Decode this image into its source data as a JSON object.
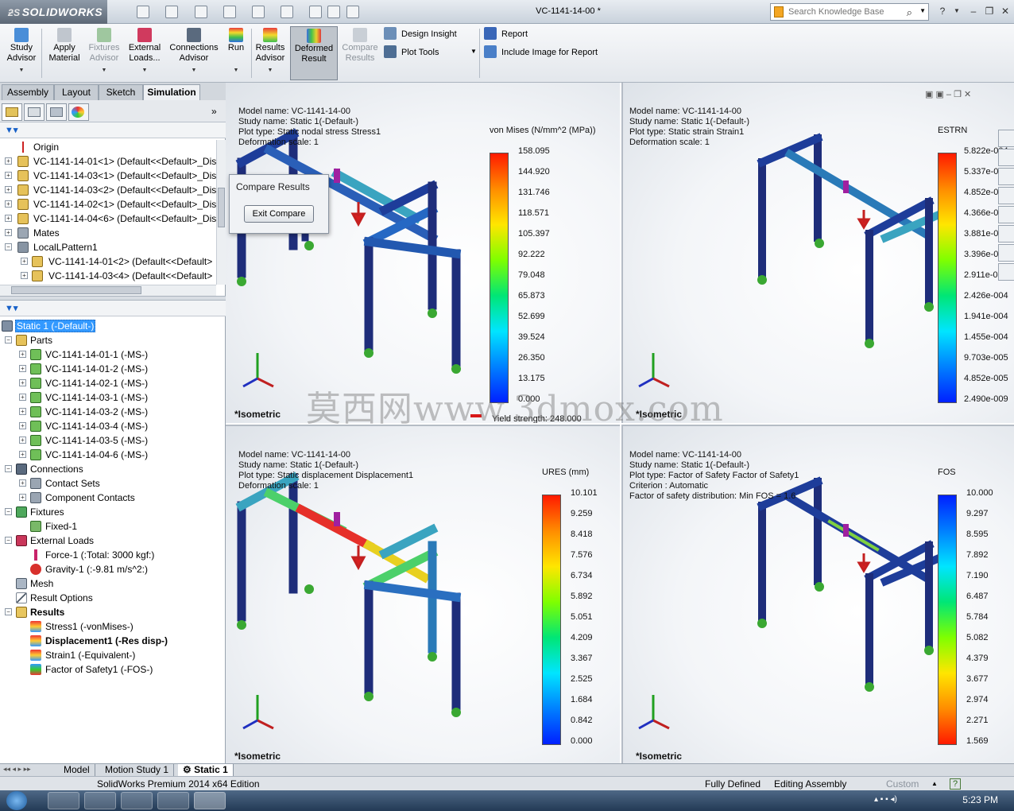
{
  "app": {
    "logo_text": "SOLIDWORKS",
    "doc_title": "VC-1141-14-00 *",
    "search_placeholder": "Search Knowledge Base",
    "help_label": "?"
  },
  "command_manager": {
    "buttons": [
      {
        "label1": "Study",
        "label2": "Advisor",
        "icon": "study-advisor-icon"
      },
      {
        "label1": "Apply",
        "label2": "Material",
        "icon": "apply-material-icon"
      },
      {
        "label1": "Fixtures",
        "label2": "Advisor",
        "icon": "fixtures-advisor-icon"
      },
      {
        "label1": "External",
        "label2": "Loads...",
        "icon": "external-loads-icon"
      },
      {
        "label1": "Connections",
        "label2": "Advisor",
        "icon": "connections-advisor-icon"
      },
      {
        "label1": "Run",
        "label2": "",
        "icon": "run-icon"
      },
      {
        "label1": "Results",
        "label2": "Advisor",
        "icon": "results-advisor-icon"
      },
      {
        "label1": "Deformed",
        "label2": "Result",
        "icon": "deformed-result-icon"
      },
      {
        "label1": "Compare",
        "label2": "Results",
        "icon": "compare-results-icon"
      }
    ],
    "design_insight": "Design Insight",
    "plot_tools": "Plot Tools",
    "report": "Report",
    "include_image": "Include Image for Report"
  },
  "tabs": [
    "Assembly",
    "Layout",
    "Sketch",
    "Simulation"
  ],
  "feature_tree": [
    {
      "label": "Origin"
    },
    {
      "label": "VC-1141-14-01<1> (Default<<Default>_Dis"
    },
    {
      "label": "VC-1141-14-03<1> (Default<<Default>_Dis"
    },
    {
      "label": "VC-1141-14-03<2> (Default<<Default>_Dis"
    },
    {
      "label": "VC-1141-14-02<1> (Default<<Default>_Dis"
    },
    {
      "label": "VC-1141-14-04<6> (Default<<Default>_Dis"
    },
    {
      "label": "Mates"
    },
    {
      "label": "LocalLPattern1"
    },
    {
      "label": "VC-1141-14-01<2> (Default<<Default>"
    },
    {
      "label": "VC-1141-14-03<4> (Default<<Default>"
    }
  ],
  "sim_tree": [
    {
      "label": "Static 1 (-Default-)"
    },
    {
      "label": "Parts"
    },
    {
      "label": "VC-1141-14-01-1 (-MS-)"
    },
    {
      "label": "VC-1141-14-01-2 (-MS-)"
    },
    {
      "label": "VC-1141-14-02-1 (-MS-)"
    },
    {
      "label": "VC-1141-14-03-1 (-MS-)"
    },
    {
      "label": "VC-1141-14-03-2 (-MS-)"
    },
    {
      "label": "VC-1141-14-03-4 (-MS-)"
    },
    {
      "label": "VC-1141-14-03-5 (-MS-)"
    },
    {
      "label": "VC-1141-14-04-6 (-MS-)"
    },
    {
      "label": "Connections"
    },
    {
      "label": "Contact Sets"
    },
    {
      "label": "Component Contacts"
    },
    {
      "label": "Fixtures"
    },
    {
      "label": "Fixed-1"
    },
    {
      "label": "External Loads"
    },
    {
      "label": "Force-1 (:Total: 3000 kgf:)"
    },
    {
      "label": "Gravity-1 (:-9.81 m/s^2:)"
    },
    {
      "label": "Mesh"
    },
    {
      "label": "Result Options"
    },
    {
      "label": "Results"
    },
    {
      "label": "Stress1 (-vonMises-)"
    },
    {
      "label": "Displacement1 (-Res disp-)"
    },
    {
      "label": "Strain1 (-Equivalent-)"
    },
    {
      "label": "Factor of Safety1 (-FOS-)"
    }
  ],
  "compare_dialog": {
    "title": "Compare Results",
    "exit_button": "Exit Compare"
  },
  "viewports": [
    {
      "info": [
        "Model name: VC-1141-14-00",
        "Study name: Static 1(-Default-)",
        "Plot type: Static nodal stress Stress1",
        "Deformation scale: 1"
      ],
      "legend_title": "von Mises (N/mm^2 (MPa))",
      "legend_values": [
        "158.095",
        "144.920",
        "131.746",
        "118.571",
        "105.397",
        "92.222",
        "79.048",
        "65.873",
        "52.699",
        "39.524",
        "26.350",
        "13.175",
        "0.000"
      ],
      "yield": "Yield strength: 248.000",
      "view_label": "*Isometric",
      "colormap": "rainbow-top-red"
    },
    {
      "info": [
        "Model name: VC-1141-14-00",
        "Study name: Static 1(-Default-)",
        "Plot type: Static strain Strain1",
        "Deformation scale: 1"
      ],
      "legend_title": "ESTRN",
      "legend_values": [
        "5.822e-004",
        "5.337e-004",
        "4.852e-004",
        "4.366e-004",
        "3.881e-004",
        "3.396e-004",
        "2.911e-004",
        "2.426e-004",
        "1.941e-004",
        "1.455e-004",
        "9.703e-005",
        "4.852e-005",
        "2.490e-009"
      ],
      "view_label": "*Isometric",
      "colormap": "rainbow-top-red"
    },
    {
      "info": [
        "Model name: VC-1141-14-00",
        "Study name: Static 1(-Default-)",
        "Plot type: Static displacement Displacement1",
        "Deformation scale: 1"
      ],
      "legend_title": "URES (mm)",
      "legend_values": [
        "10.101",
        "9.259",
        "8.418",
        "7.576",
        "6.734",
        "5.892",
        "5.051",
        "4.209",
        "3.367",
        "2.525",
        "1.684",
        "0.842",
        "0.000"
      ],
      "view_label": "*Isometric",
      "colormap": "rainbow-top-red"
    },
    {
      "info": [
        "Model name: VC-1141-14-00",
        "Study name: Static 1(-Default-)",
        "Plot type: Factor of Safety Factor of Safety1",
        "Criterion : Automatic",
        "Factor of safety distribution: Min FOS = 1.6"
      ],
      "legend_title": "FOS",
      "legend_values": [
        "10.000",
        "9.297",
        "8.595",
        "7.892",
        "7.190",
        "6.487",
        "5.784",
        "5.082",
        "4.379",
        "3.677",
        "2.974",
        "2.271",
        "1.569"
      ],
      "view_label": "*Isometric",
      "colormap": "rainbow-top-blue"
    }
  ],
  "watermark": "莫西网www.3dmox.com",
  "bottom_tabs": [
    "Model",
    "Motion Study 1",
    "Static 1"
  ],
  "status": {
    "edition": "SolidWorks Premium 2014 x64 Edition",
    "state": "Fully Defined",
    "mode": "Editing Assembly",
    "units": "Custom",
    "help": "?"
  },
  "clock": "5:23 PM"
}
